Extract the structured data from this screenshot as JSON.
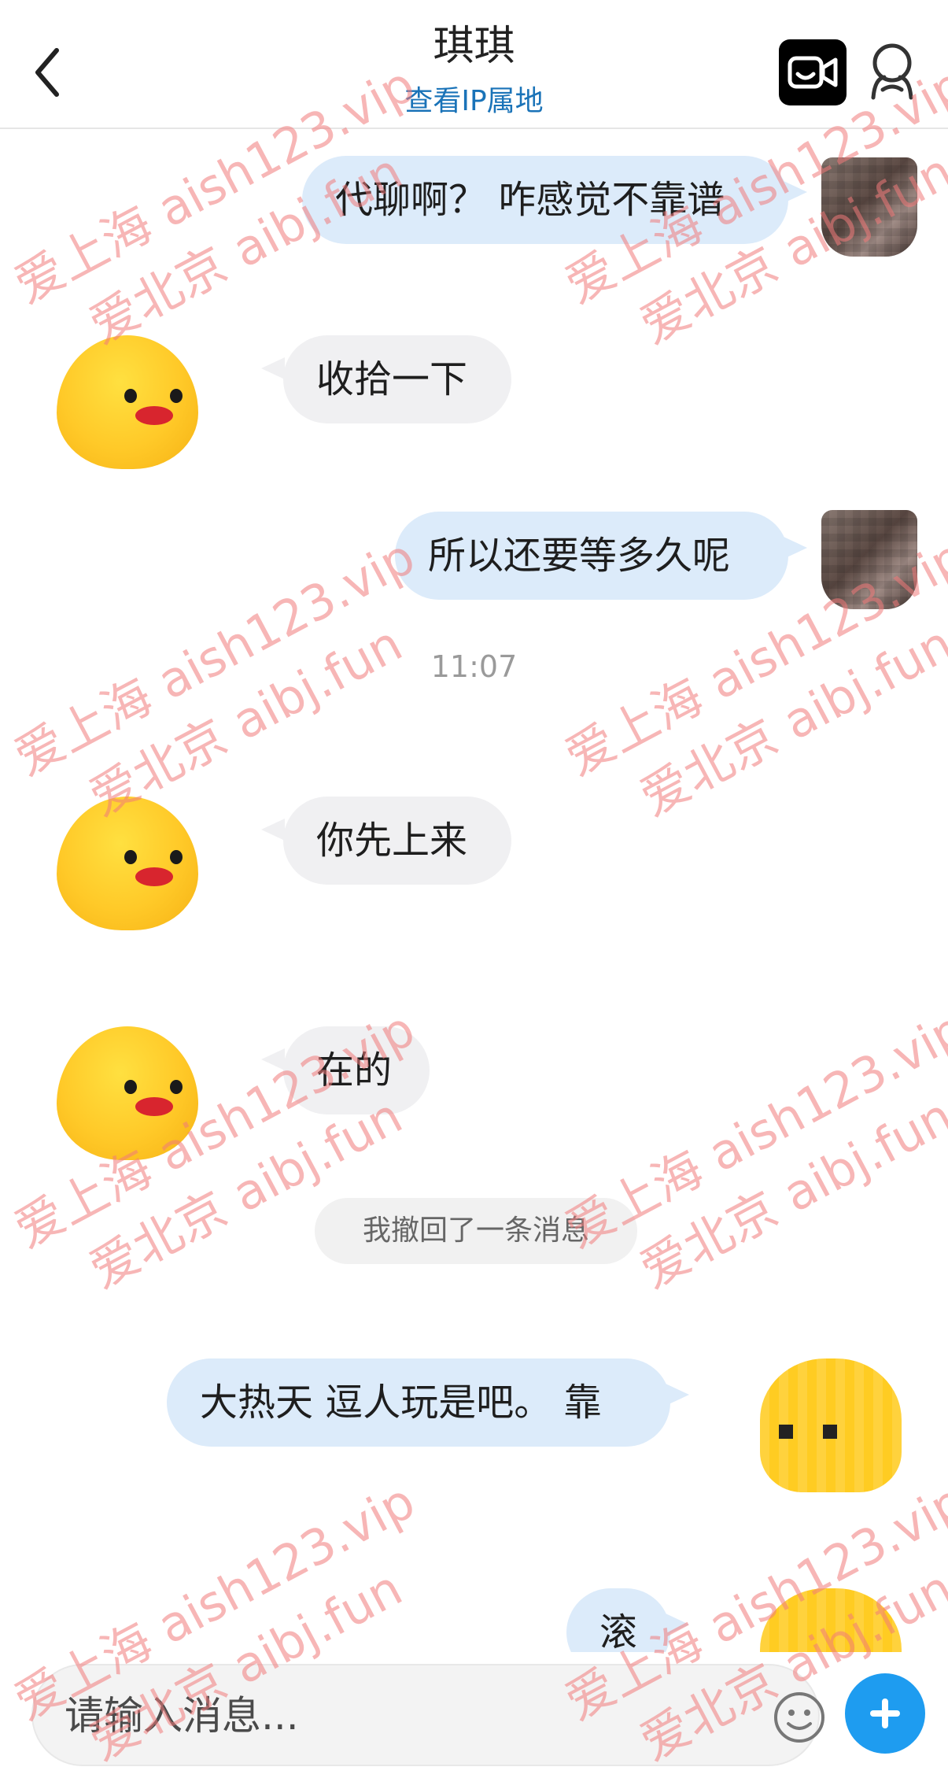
{
  "header": {
    "title": "琪琪",
    "subtitle": "查看IP属地"
  },
  "messages": [
    {
      "side": "out",
      "text": "代聊啊？ 咋感觉不靠谱"
    },
    {
      "side": "in",
      "text": "收拾一下"
    },
    {
      "side": "out",
      "text": "所以还要等多久呢"
    },
    {
      "type": "time",
      "text": "11:07"
    },
    {
      "side": "in",
      "text": "你先上来"
    },
    {
      "side": "in",
      "text": "在的"
    },
    {
      "type": "system",
      "text": "我撤回了一条消息"
    },
    {
      "side": "out",
      "text": "大热天 逗人玩是吧。 靠"
    },
    {
      "side": "out",
      "text": "滚"
    }
  ],
  "composer": {
    "placeholder": "请输入消息..."
  },
  "watermark": {
    "line1": "爱上海 aish123.vip",
    "line2": "爱北京 aibj.fun"
  },
  "colors": {
    "out_bubble": "#dcebfa",
    "in_bubble": "#f0f0f2",
    "accent": "#1e9cf0",
    "subtitle": "#1a73b8"
  },
  "icons": [
    "back-arrow-icon",
    "video-call-icon",
    "profile-icon",
    "emoji-icon",
    "plus-icon"
  ]
}
